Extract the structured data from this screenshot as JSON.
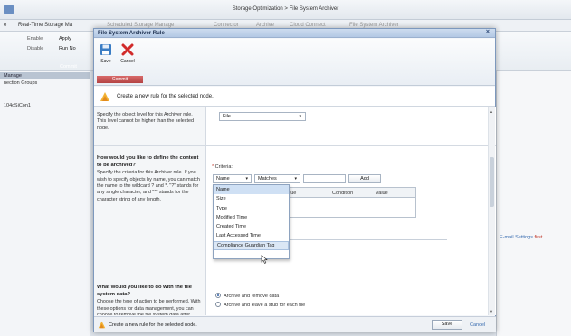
{
  "app": {
    "window_title": "Storage Optimization > File System Archiver",
    "menu": [
      "e",
      "Real-Time Storage Ma",
      "Scheduled Storage Manage",
      "Connector",
      "Archive",
      "Cloud Connect",
      "File System Archiver"
    ],
    "toolbar": [
      "Enable",
      "Apply",
      "Disable",
      "Run No",
      "Commit"
    ],
    "left_panel": {
      "manage": "Manage",
      "connection_groups": "nection Groups",
      "item": "104cSiCon1"
    },
    "right_panel": {
      "email_settings": "E-mail Settings",
      "first": "first."
    }
  },
  "dialog": {
    "title": "File System Archiver Rule",
    "close": "×",
    "ribbon": {
      "save": "Save",
      "cancel": "Cancel",
      "commit": "Commit"
    },
    "info": "Create a new rule for the selected node.",
    "sections": [
      {
        "heading": "",
        "text": "Specify the object level for this Archiver rule. This level cannot be higher than the selected node."
      },
      {
        "heading": "How would you like to define the content to be archived?",
        "text": "Specify the criteria for this Archiver rule. If you wish to specify objects by name, you can match the name to the wildcard ? and *. \"?\" stands for any single character, and \"*\" stands for the character string of any length."
      },
      {
        "heading": "What would you like to do with the file system data?",
        "text": "Choose the type of action to be performed. With these options for data management, you can choose to remove the file system data after being archived or declare files as"
      }
    ],
    "object_level": {
      "value": "File"
    },
    "criteria": {
      "label": "Criteria:",
      "required_mark": "*",
      "field": "Name",
      "operator": "Matches",
      "value": "",
      "add": "Add",
      "grid_columns": [
        "lue",
        "Condition",
        "Value"
      ],
      "options_text": "ons"
    },
    "dropdown": [
      "Name",
      "Size",
      "Type",
      "Modified Time",
      "Created Time",
      "Last Accessed Time",
      "Compliance Guardian Tag"
    ],
    "actions": [
      {
        "label": "Archive and remove data",
        "selected": true
      },
      {
        "label": "Archive and leave a stub for each file",
        "selected": false
      }
    ],
    "footer": {
      "text": "Create a new rule for the selected node.",
      "save": "Save",
      "cancel": "Cancel"
    }
  }
}
